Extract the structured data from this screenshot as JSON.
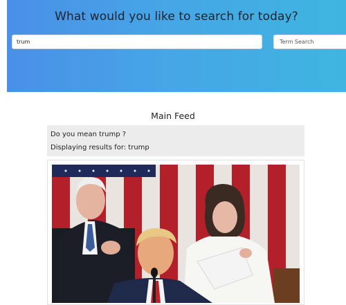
{
  "header": {
    "title": "What would you like to search for today?",
    "gradient_start": "#4a8fe8",
    "gradient_end": "#3fb5e0"
  },
  "search": {
    "value": "trum",
    "type_label": "Term Search"
  },
  "feed": {
    "title": "Main Feed",
    "suggestion": "Do you mean trump ?",
    "results_label": "Displaying results for: trump"
  },
  "post": {
    "image": "photo of three people in front of an american flag"
  }
}
